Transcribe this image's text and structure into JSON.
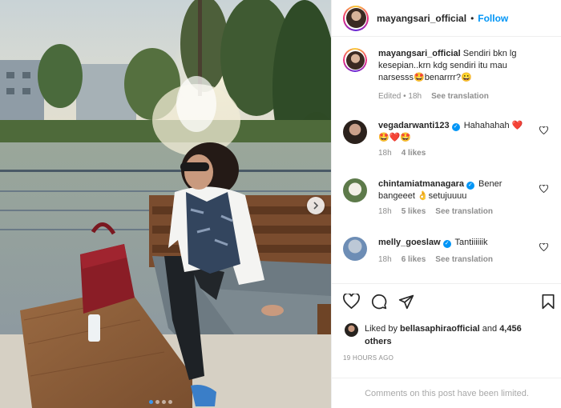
{
  "header": {
    "username": "mayangsari_official",
    "separator": "•",
    "follow_label": "Follow"
  },
  "caption": {
    "username": "mayangsari_official",
    "text": "Sendiri bkn lg kesepian..krn kdg sendiri itu mau narsesss🤩benarrrr?😀",
    "edited": "Edited",
    "time": "18h",
    "see_translation": "See translation"
  },
  "comments": [
    {
      "username": "vegadarwanti123",
      "verified": true,
      "text": "Hahahahah ❤️🤩❤️🤩",
      "time": "18h",
      "likes": "4 likes",
      "see_translation": ""
    },
    {
      "username": "chintamiatmanagara",
      "verified": true,
      "text": "Bener bangeeet 👌setujuuuu",
      "time": "18h",
      "likes": "5 likes",
      "see_translation": "See translation"
    },
    {
      "username": "melly_goeslaw",
      "verified": true,
      "text": "Tantiiiiiik",
      "time": "18h",
      "likes": "6 likes",
      "see_translation": "See translation"
    }
  ],
  "likes": {
    "liked_by": "Liked by",
    "user": "bellasaphiraofficial",
    "and": "and",
    "others": "4,456 others"
  },
  "time_ago": "19 HOURS AGO",
  "comments_limited": "Comments on this post have been limited.",
  "carousel": {
    "slide_count": 4,
    "active_slide": 1
  },
  "colors": {
    "accent": "#0095f6",
    "muted": "#8e8e8e",
    "bag": "#8a1d26"
  },
  "icons": [
    "heart-icon",
    "comment-icon",
    "share-icon",
    "bookmark-icon",
    "chevron-right-icon",
    "verified-icon"
  ]
}
